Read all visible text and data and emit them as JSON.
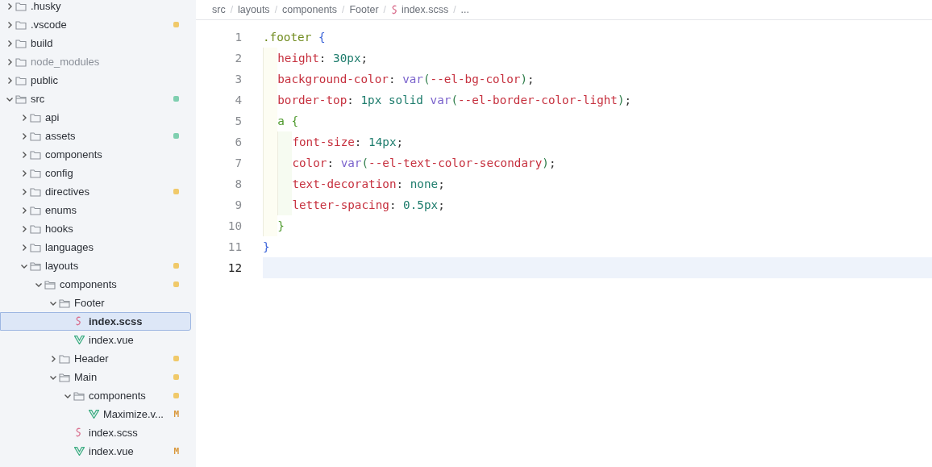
{
  "sidebar": {
    "tree": [
      {
        "name": ".husky",
        "kind": "folder",
        "expanded": false,
        "selected": false,
        "dimmed": false
      },
      {
        "name": ".vscode",
        "kind": "folder",
        "expanded": false,
        "selected": false,
        "dimmed": false,
        "color": "#f0c96a"
      },
      {
        "name": "build",
        "kind": "folder",
        "expanded": false,
        "selected": false,
        "dimmed": false
      },
      {
        "name": "node_modules",
        "kind": "folder",
        "expanded": false,
        "selected": false,
        "dimmed": true
      },
      {
        "name": "public",
        "kind": "folder",
        "expanded": false,
        "selected": false,
        "dimmed": false
      },
      {
        "name": "src",
        "kind": "folder",
        "expanded": true,
        "selected": false,
        "dimmed": false,
        "color": "#7fcfb0",
        "children": [
          {
            "name": "api",
            "kind": "folder",
            "expanded": false,
            "selected": false,
            "dimmed": false
          },
          {
            "name": "assets",
            "kind": "folder",
            "expanded": false,
            "selected": false,
            "dimmed": false,
            "color": "#7fcfb0"
          },
          {
            "name": "components",
            "kind": "folder",
            "expanded": false,
            "selected": false,
            "dimmed": false
          },
          {
            "name": "config",
            "kind": "folder",
            "expanded": false,
            "selected": false,
            "dimmed": false
          },
          {
            "name": "directives",
            "kind": "folder",
            "expanded": false,
            "selected": false,
            "dimmed": false,
            "color": "#f0c96a"
          },
          {
            "name": "enums",
            "kind": "folder",
            "expanded": false,
            "selected": false,
            "dimmed": false
          },
          {
            "name": "hooks",
            "kind": "folder",
            "expanded": false,
            "selected": false,
            "dimmed": false
          },
          {
            "name": "languages",
            "kind": "folder",
            "expanded": false,
            "selected": false,
            "dimmed": false
          },
          {
            "name": "layouts",
            "kind": "folder",
            "expanded": true,
            "selected": false,
            "dimmed": false,
            "color": "#f0c96a",
            "children": [
              {
                "name": "components",
                "kind": "folder",
                "expanded": true,
                "selected": false,
                "dimmed": false,
                "color": "#f0c96a",
                "children": [
                  {
                    "name": "Footer",
                    "kind": "folder",
                    "expanded": true,
                    "selected": false,
                    "dimmed": false,
                    "children": [
                      {
                        "name": "index.scss",
                        "kind": "scss",
                        "selected": true,
                        "dimmed": false
                      },
                      {
                        "name": "index.vue",
                        "kind": "vue",
                        "selected": false,
                        "dimmed": false
                      }
                    ]
                  },
                  {
                    "name": "Header",
                    "kind": "folder",
                    "expanded": false,
                    "selected": false,
                    "dimmed": false,
                    "color": "#f0c96a"
                  },
                  {
                    "name": "Main",
                    "kind": "folder",
                    "expanded": true,
                    "selected": false,
                    "dimmed": false,
                    "color": "#f0c96a",
                    "children": [
                      {
                        "name": "components",
                        "kind": "folder",
                        "expanded": true,
                        "selected": false,
                        "dimmed": false,
                        "color": "#f0c96a",
                        "children": [
                          {
                            "name": "Maximize.v...",
                            "kind": "vue",
                            "selected": false,
                            "dimmed": false,
                            "badge": "M"
                          }
                        ]
                      },
                      {
                        "name": "index.scss",
                        "kind": "scss",
                        "selected": false,
                        "dimmed": false
                      },
                      {
                        "name": "index.vue",
                        "kind": "vue",
                        "selected": false,
                        "dimmed": false,
                        "badge": "M"
                      }
                    ]
                  }
                ]
              }
            ]
          }
        ]
      }
    ]
  },
  "breadcrumb_separator": "/",
  "breadcrumbs": [
    {
      "label": "src",
      "kind": "folder"
    },
    {
      "label": "layouts",
      "kind": "folder"
    },
    {
      "label": "components",
      "kind": "folder"
    },
    {
      "label": "Footer",
      "kind": "folder"
    },
    {
      "label": "index.scss",
      "kind": "scss"
    },
    {
      "label": "...",
      "kind": "more"
    }
  ],
  "editor": {
    "lines": [
      {
        "number": "1",
        "current": false,
        "text": ".footer {"
      },
      {
        "number": "2",
        "current": false,
        "text": "  height: 30px;"
      },
      {
        "number": "3",
        "current": false,
        "text": "  background-color: var(--el-bg-color);"
      },
      {
        "number": "4",
        "current": false,
        "text": "  border-top: 1px solid var(--el-border-color-light);"
      },
      {
        "number": "5",
        "current": false,
        "text": "  a {"
      },
      {
        "number": "6",
        "current": false,
        "text": "    font-size: 14px;"
      },
      {
        "number": "7",
        "current": false,
        "text": "    color: var(--el-text-color-secondary);"
      },
      {
        "number": "8",
        "current": false,
        "text": "    text-decoration: none;"
      },
      {
        "number": "9",
        "current": false,
        "text": "    letter-spacing: 0.5px;"
      },
      {
        "number": "10",
        "current": false,
        "text": "  }"
      },
      {
        "number": "11",
        "current": false,
        "text": "}"
      },
      {
        "number": "12",
        "current": true
      }
    ]
  }
}
